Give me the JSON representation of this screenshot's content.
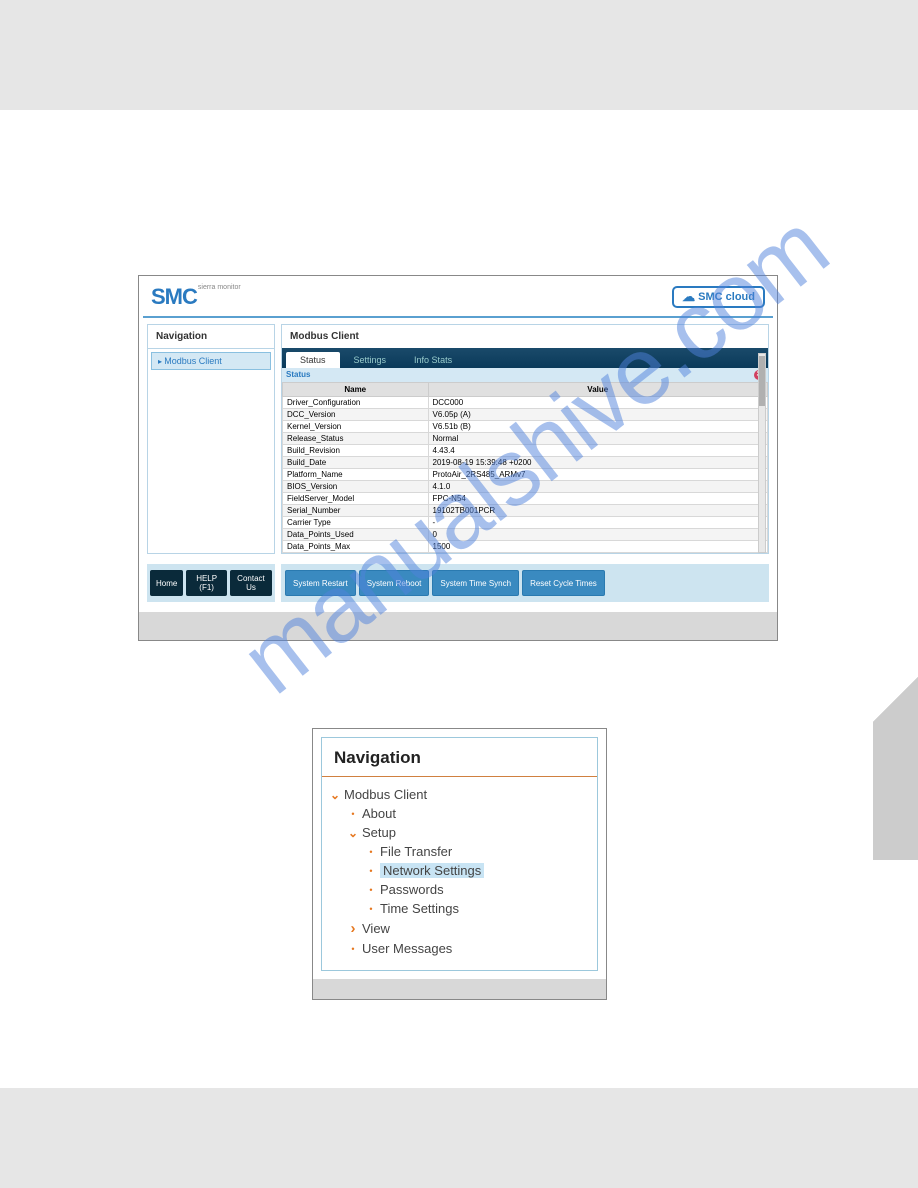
{
  "watermark": "manualshive.com",
  "screenshot1": {
    "logo_main": "SMC",
    "logo_sub": "sierra monitor",
    "cloud_button": "SMC cloud",
    "nav_header": "Navigation",
    "nav_items": [
      "Modbus Client"
    ],
    "main_title": "Modbus Client",
    "tabs": [
      "Status",
      "Settings",
      "Info Stats"
    ],
    "status_label": "Status",
    "table_headers": [
      "Name",
      "Value"
    ],
    "rows": [
      {
        "name": "Driver_Configuration",
        "value": "DCC000"
      },
      {
        "name": "DCC_Version",
        "value": "V6.05p (A)"
      },
      {
        "name": "Kernel_Version",
        "value": "V6.51b (B)"
      },
      {
        "name": "Release_Status",
        "value": "Normal"
      },
      {
        "name": "Build_Revision",
        "value": "4.43.4"
      },
      {
        "name": "Build_Date",
        "value": "2019-08-19 15:39:48 +0200"
      },
      {
        "name": "Platform_Name",
        "value": "ProtoAir_2RS485_ARMv7"
      },
      {
        "name": "BIOS_Version",
        "value": "4.1.0"
      },
      {
        "name": "FieldServer_Model",
        "value": "FPC-N54"
      },
      {
        "name": "Serial_Number",
        "value": "19102TB001PCR"
      },
      {
        "name": "Carrier Type",
        "value": "-"
      },
      {
        "name": "Data_Points_Used",
        "value": "0"
      },
      {
        "name": "Data_Points_Max",
        "value": "1500"
      }
    ],
    "footer_left_buttons": [
      "Home",
      "HELP (F1)",
      "Contact Us"
    ],
    "footer_right_buttons": [
      "System Restart",
      "System Reboot",
      "System Time Synch",
      "Reset Cycle Times"
    ]
  },
  "screenshot2": {
    "header": "Navigation",
    "tree": [
      {
        "icon": "chevron-down",
        "label": "Modbus Client",
        "indent": 0
      },
      {
        "icon": "bullet",
        "label": "About",
        "indent": 1
      },
      {
        "icon": "chevron-down",
        "label": "Setup",
        "indent": 1
      },
      {
        "icon": "bullet",
        "label": "File Transfer",
        "indent": 2
      },
      {
        "icon": "bullet",
        "label": "Network Settings",
        "indent": 2,
        "selected": true
      },
      {
        "icon": "bullet",
        "label": "Passwords",
        "indent": 2
      },
      {
        "icon": "bullet",
        "label": "Time Settings",
        "indent": 2
      },
      {
        "icon": "chevron-right",
        "label": "View",
        "indent": 1
      },
      {
        "icon": "bullet",
        "label": "User Messages",
        "indent": 1
      }
    ]
  }
}
